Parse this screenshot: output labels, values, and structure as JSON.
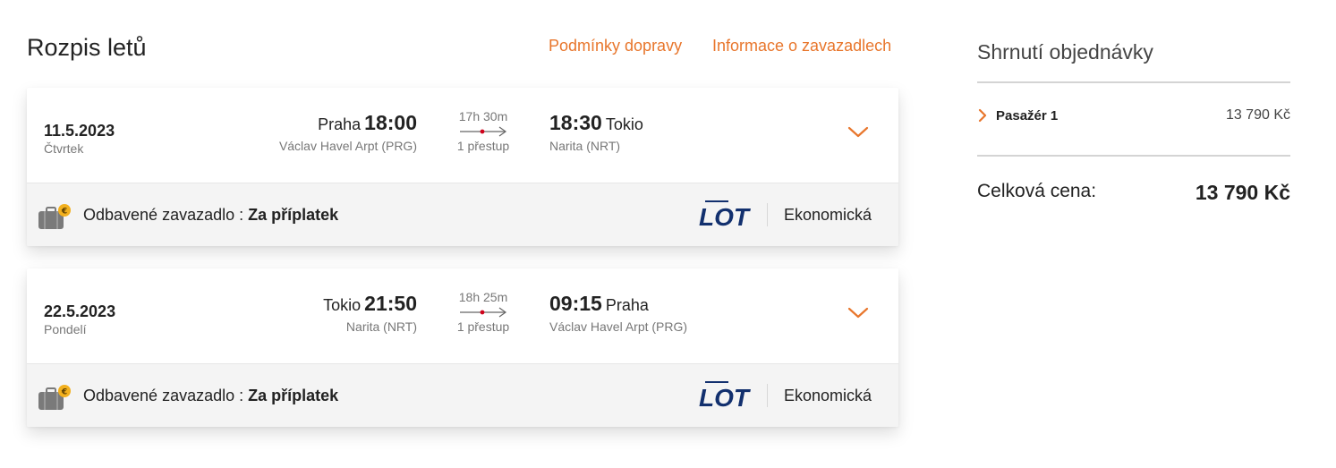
{
  "page": {
    "title": "Rozpis letů",
    "links": {
      "conditions": "Podmínky dopravy",
      "baggage": "Informace o zavazadlech"
    }
  },
  "flights": [
    {
      "date": "11.5.2023",
      "weekday": "Čtvrtek",
      "departure": {
        "city": "Praha",
        "time": "18:00",
        "airport": "Václav Havel Arpt (PRG)"
      },
      "duration": "17h 30m",
      "stops": "1 přestup",
      "arrival": {
        "time": "18:30",
        "city": "Tokio",
        "airport": "Narita (NRT)"
      },
      "baggage_label": "Odbavené zavazadlo : ",
      "baggage_value": "Za příplatek",
      "airline_logo": "LOT",
      "cabin": "Ekonomická"
    },
    {
      "date": "22.5.2023",
      "weekday": "Pondelí",
      "departure": {
        "city": "Tokio",
        "time": "21:50",
        "airport": "Narita (NRT)"
      },
      "duration": "18h 25m",
      "stops": "1 přestup",
      "arrival": {
        "time": "09:15",
        "city": "Praha",
        "airport": "Václav Havel Arpt (PRG)"
      },
      "baggage_label": "Odbavené zavazadlo : ",
      "baggage_value": "Za příplatek",
      "airline_logo": "LOT",
      "cabin": "Ekonomická"
    }
  ],
  "summary": {
    "title": "Shrnutí objednávky",
    "passenger_label": "Pasažér 1",
    "passenger_price": "13 790 Kč",
    "total_label": "Celková cena:",
    "total_price": "13 790 Kč"
  },
  "colors": {
    "accent": "#e8762c",
    "airline_blue": "#12306e",
    "stop_dot": "#d0021b"
  },
  "icons": [
    "baggage-fee-icon",
    "chevron-down-icon",
    "chevron-right-icon",
    "route-arrow-icon"
  ]
}
